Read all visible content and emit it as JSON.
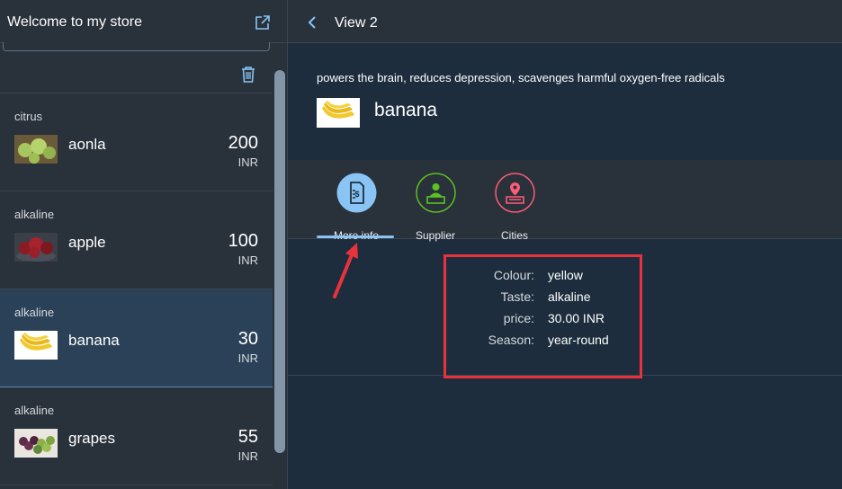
{
  "master": {
    "title": "Welcome to my store",
    "items": [
      {
        "category": "citrus",
        "name": "aonla",
        "price": "200",
        "unit": "INR",
        "thumb": "aonla-image"
      },
      {
        "category": "alkaline",
        "name": "apple",
        "price": "100",
        "unit": "INR",
        "thumb": "apple-image"
      },
      {
        "category": "alkaline",
        "name": "banana",
        "price": "30",
        "unit": "INR",
        "thumb": "banana-image",
        "selected": true
      },
      {
        "category": "alkaline",
        "name": "grapes",
        "price": "55",
        "unit": "INR",
        "thumb": "grapes-image"
      }
    ]
  },
  "detail": {
    "title": "View 2",
    "description": "powers the brain, reduces depression, scavenges harmful oxygen-free radicals",
    "object_title": "banana",
    "tabs": [
      {
        "label": "More info",
        "icon": "document-dollar-icon",
        "color": "#89c4f4",
        "selected": true
      },
      {
        "label": "Supplier",
        "icon": "supplier-icon",
        "color": "#5dc122"
      },
      {
        "label": "Cities",
        "icon": "map-pin-icon",
        "color": "#ff5c77"
      }
    ],
    "form": [
      {
        "label": "Colour:",
        "value": "yellow"
      },
      {
        "label": "Taste:",
        "value": "alkaline"
      },
      {
        "label": "price:",
        "value": "30.00 INR"
      },
      {
        "label": "Season:",
        "value": "year-round"
      }
    ]
  },
  "colors": {
    "background": "#1d2d3e",
    "shell": "#29313a",
    "selected_row": "#2b4158",
    "accent": "#89c4f4",
    "annotation_red": "#e8323c"
  }
}
